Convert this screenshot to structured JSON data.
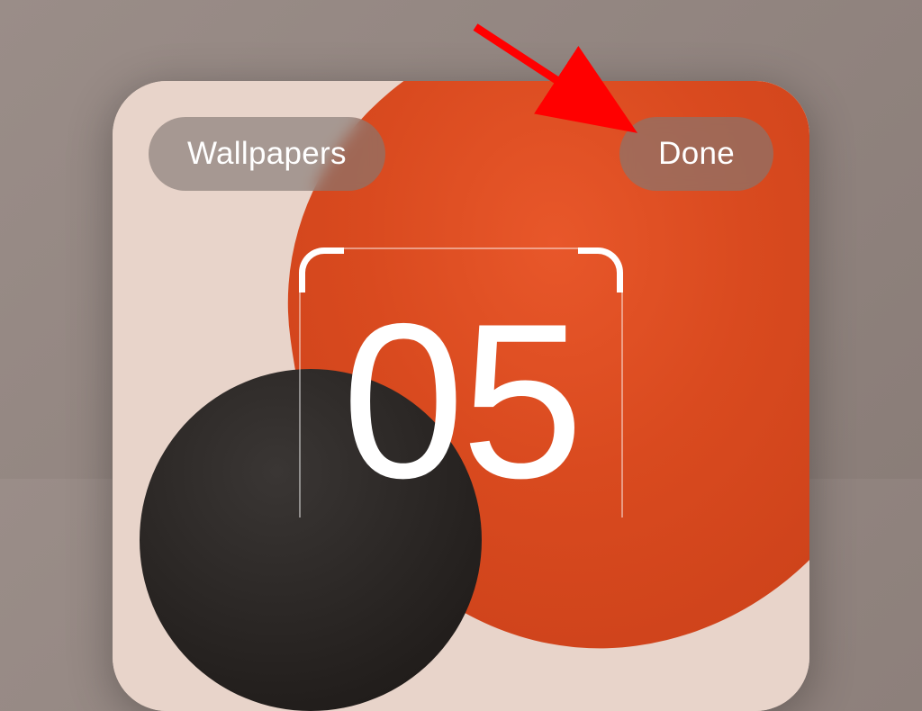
{
  "toolbar": {
    "wallpapers_label": "Wallpapers",
    "done_label": "Done"
  },
  "clock": {
    "hour": "05"
  },
  "annotation": {
    "color": "#ff0000",
    "target": "done-button"
  }
}
